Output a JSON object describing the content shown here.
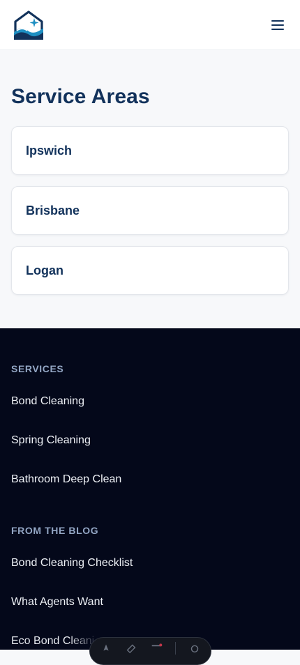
{
  "header": {
    "logo_icon": "house-wave-sparkle-logo-icon",
    "menu_icon": "hamburger-menu-icon"
  },
  "main": {
    "title": "Service Areas",
    "areas": [
      {
        "label": "Ipswich"
      },
      {
        "label": "Brisbane"
      },
      {
        "label": "Logan"
      }
    ]
  },
  "footer": {
    "services_heading": "SERVICES",
    "services": [
      {
        "label": "Bond Cleaning"
      },
      {
        "label": "Spring Cleaning"
      },
      {
        "label": "Bathroom Deep Clean"
      }
    ],
    "blog_heading": "FROM THE BLOG",
    "blog": [
      {
        "label": "Bond Cleaning Checklist"
      },
      {
        "label": "What Agents Want"
      },
      {
        "label": "Eco Bond Cleani"
      }
    ]
  },
  "floating_toolbar": {
    "icons": [
      "inspect-icon",
      "ruler-icon",
      "list-icon",
      "settings-icon"
    ]
  },
  "colors": {
    "brand_navy": "#12325b",
    "footer_bg": "#04081a",
    "footer_heading": "#93a6c4",
    "logo_teal": "#1e8fc2"
  }
}
